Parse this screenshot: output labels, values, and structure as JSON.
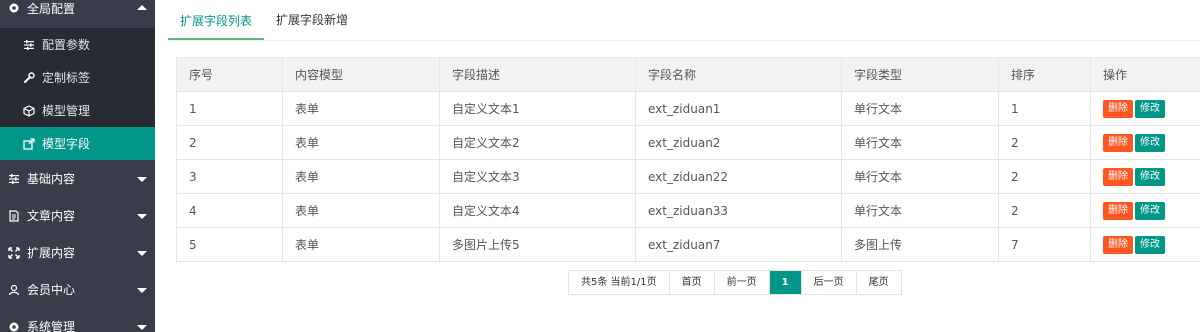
{
  "sidebar": {
    "global_group": {
      "label": "全局配置",
      "icon": "gear-icon"
    },
    "global_items": [
      {
        "label": "配置参数",
        "icon": "sliders-icon"
      },
      {
        "label": "定制标签",
        "icon": "wrench-icon"
      },
      {
        "label": "模型管理",
        "icon": "cube-icon"
      },
      {
        "label": "模型字段",
        "icon": "external-link-icon",
        "active": true
      }
    ],
    "groups": [
      {
        "label": "基础内容",
        "icon": "sliders-icon"
      },
      {
        "label": "文章内容",
        "icon": "document-icon"
      },
      {
        "label": "扩展内容",
        "icon": "expand-icon"
      },
      {
        "label": "会员中心",
        "icon": "user-icon"
      },
      {
        "label": "系统管理",
        "icon": "gear-icon"
      }
    ]
  },
  "tabs": [
    {
      "label": "扩展字段列表",
      "active": true
    },
    {
      "label": "扩展字段新增",
      "active": false
    }
  ],
  "table": {
    "headers": [
      "序号",
      "内容模型",
      "字段描述",
      "字段名称",
      "字段类型",
      "排序",
      "操作"
    ],
    "rows": [
      {
        "no": "1",
        "model": "表单",
        "desc": "自定义文本1",
        "name": "ext_ziduan1",
        "type": "单行文本",
        "sort": "1"
      },
      {
        "no": "2",
        "model": "表单",
        "desc": "自定义文本2",
        "name": "ext_ziduan2",
        "type": "单行文本",
        "sort": "2"
      },
      {
        "no": "3",
        "model": "表单",
        "desc": "自定义文本3",
        "name": "ext_ziduan22",
        "type": "单行文本",
        "sort": "2"
      },
      {
        "no": "4",
        "model": "表单",
        "desc": "自定义文本4",
        "name": "ext_ziduan33",
        "type": "单行文本",
        "sort": "2"
      },
      {
        "no": "5",
        "model": "表单",
        "desc": "多图片上传5",
        "name": "ext_ziduan7",
        "type": "多图上传",
        "sort": "7"
      }
    ],
    "delete_label": "删除",
    "edit_label": "修改"
  },
  "pager": {
    "info": "共5条 当前1/1页",
    "first": "首页",
    "prev": "前一页",
    "current": "1",
    "next": "后一页",
    "last": "尾页"
  },
  "colors": {
    "sidebar_bg": "#393d49",
    "submenu_bg": "#282b33",
    "accent": "#009688",
    "danger": "#ff5722"
  }
}
